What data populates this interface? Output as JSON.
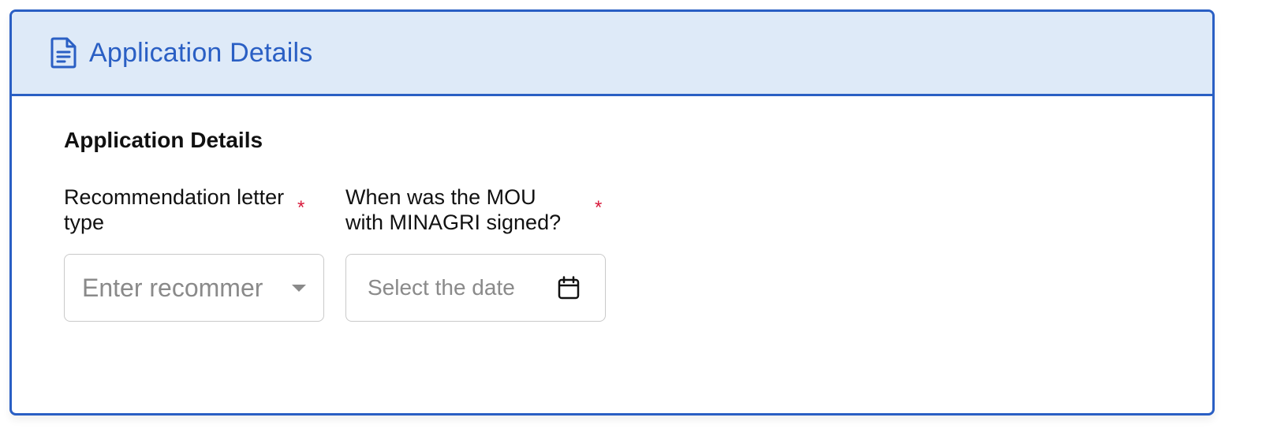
{
  "card": {
    "header_title": "Application Details",
    "header_icon": "document-icon"
  },
  "section": {
    "title": "Application Details"
  },
  "fields": [
    {
      "label": "Recommendation letter type",
      "required_mark": "*",
      "placeholder": "Enter recommer",
      "control": "dropdown",
      "icon": "chevron-down-icon"
    },
    {
      "label": "When was the MOU with MINAGRI signed?",
      "required_mark": "*",
      "placeholder": "Select the date",
      "control": "date-picker",
      "icon": "calendar-icon"
    }
  ],
  "colors": {
    "accent": "#2a5fc4",
    "header_bg": "#deeaf8",
    "required": "#d81b3c",
    "placeholder": "#8a8a8a"
  }
}
